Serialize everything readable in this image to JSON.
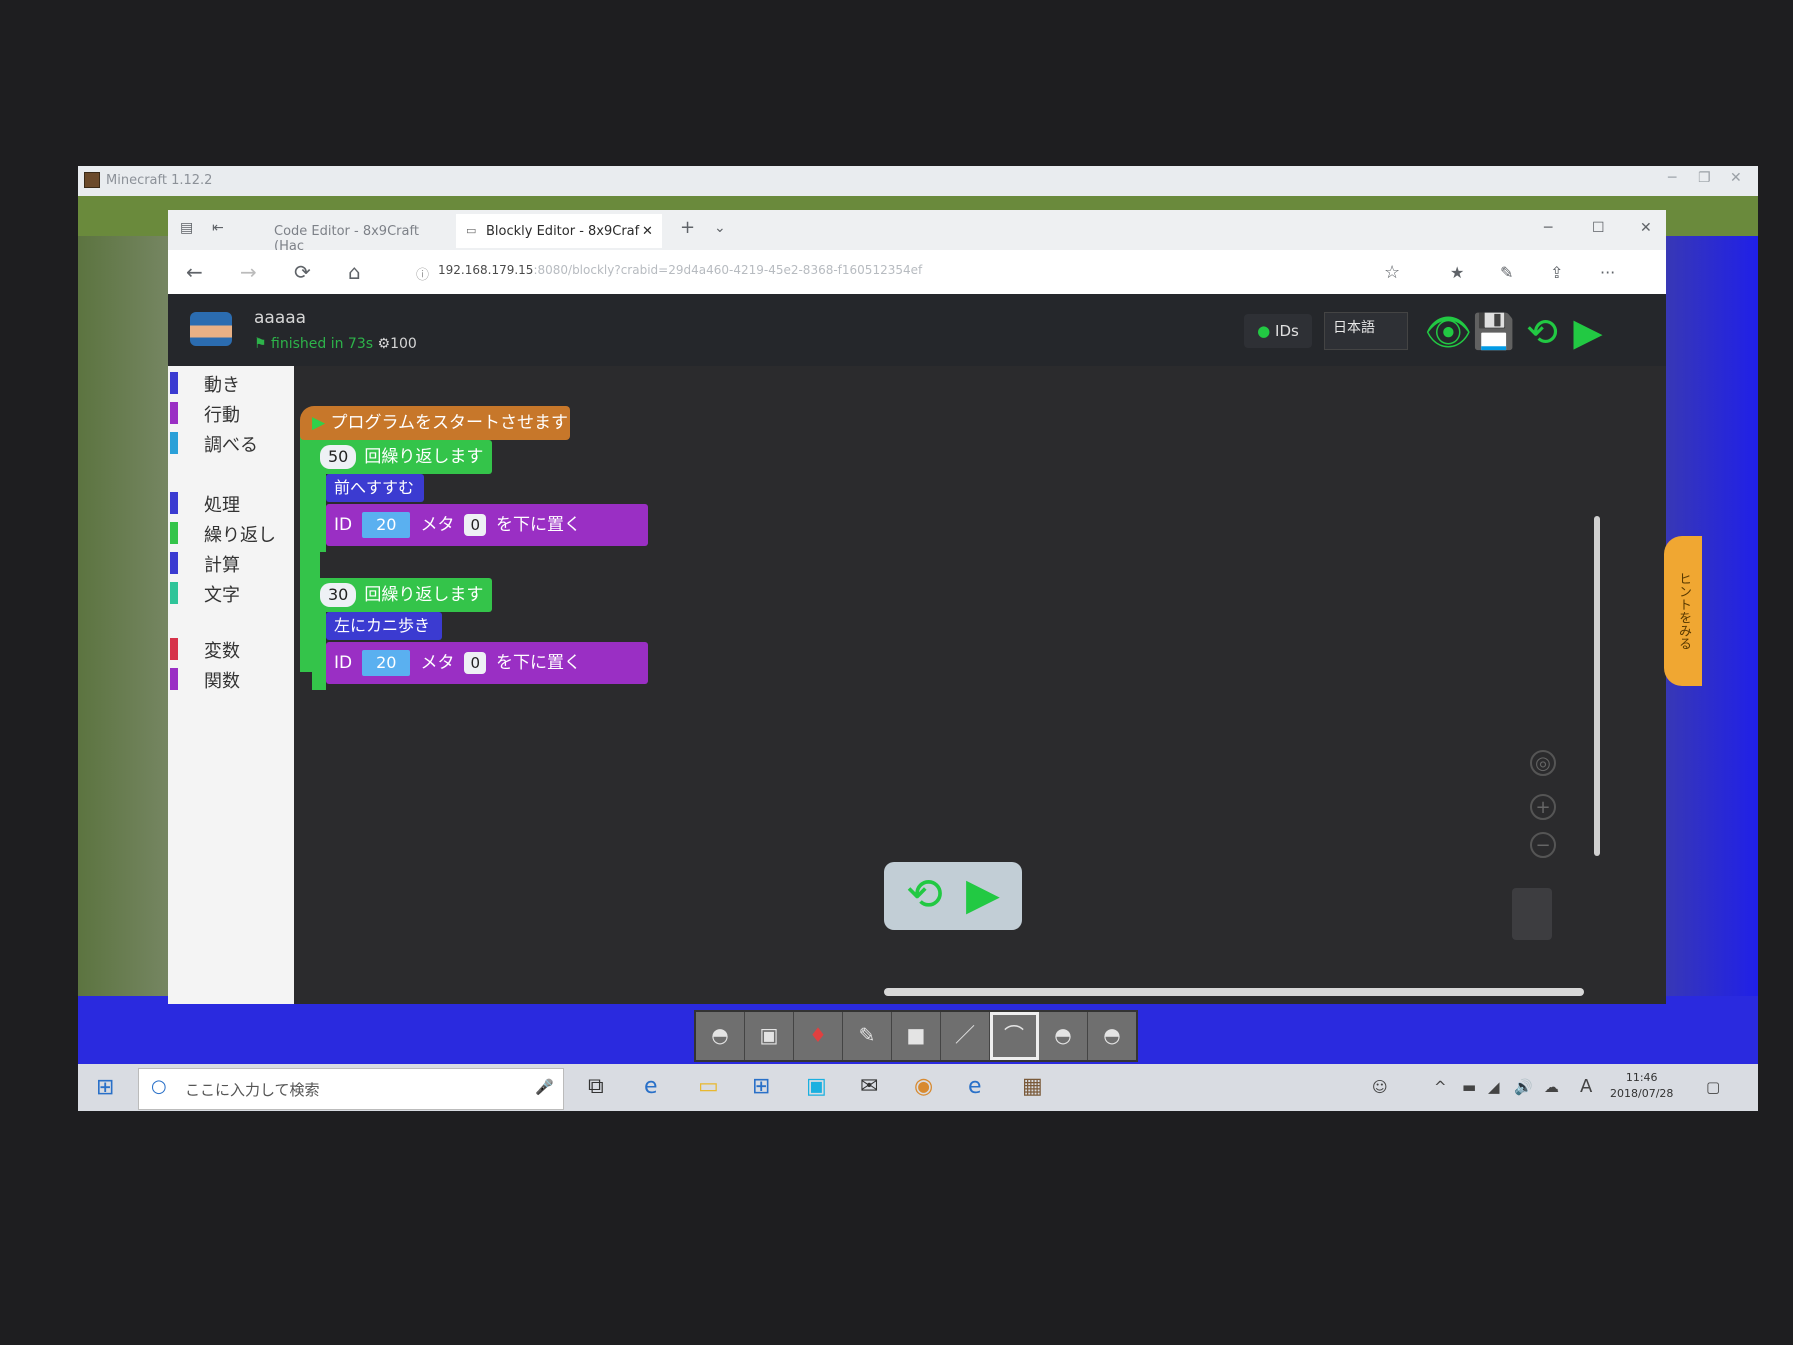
{
  "minecraft_window": {
    "title": "Minecraft 1.12.2",
    "controls": [
      "─",
      "❐",
      "✕"
    ]
  },
  "browser": {
    "tabs": [
      {
        "label": "Code Editor - 8x9Craft (Hac",
        "active": false
      },
      {
        "label": "Blockly Editor - 8x9Craf",
        "active": true
      }
    ],
    "tab_close": "✕",
    "new_tab": "+",
    "tab_menu": "⌄",
    "window_controls": [
      "─",
      "☐",
      "✕"
    ],
    "nav": {
      "back": "←",
      "forward": "→",
      "refresh": "⟳",
      "home": "⌂"
    },
    "url_host": "192.168.179.15",
    "url_rest": ":8080/blockly?crabid=29d4a460-4219-45e2-8368-f160512354ef",
    "toolbar_icons": {
      "favorite": "☆",
      "favorites": "★",
      "notes": "✎",
      "share": "⇪",
      "more": "···"
    }
  },
  "app": {
    "username": "aaaaa",
    "status_text": "finished in 73s",
    "count": "100",
    "ids_label": "IDs",
    "language": "日本語",
    "header_icons": {
      "view": "👁",
      "save": "💾",
      "reset": "⟲",
      "run": "▶"
    }
  },
  "toolbox": [
    {
      "label": "動き",
      "color": "#3b3bd1"
    },
    {
      "label": "行動",
      "color": "#9a2fc4"
    },
    {
      "label": "調べる",
      "color": "#2aa0d8"
    },
    {
      "label": "処理",
      "color": "#3b3bd1"
    },
    {
      "label": "繰り返し",
      "color": "#34c44a"
    },
    {
      "label": "計算",
      "color": "#3b3bd1"
    },
    {
      "label": "文字",
      "color": "#2fc499"
    },
    {
      "label": "変数",
      "color": "#d6334a"
    },
    {
      "label": "関数",
      "color": "#9a2fc4"
    }
  ],
  "blocks": {
    "start": "プログラムをスタートさせます",
    "loop1": {
      "count": "50",
      "label": "回繰り返します"
    },
    "move1": "前へすすむ",
    "place1": {
      "id_label": "ID",
      "id_value": "20",
      "meta_label": "メタ",
      "meta_value": "0",
      "action": "を下に置く"
    },
    "loop2": {
      "count": "30",
      "label": "回繰り返します"
    },
    "move2": "左にカニ歩き",
    "place2": {
      "id_label": "ID",
      "id_value": "20",
      "meta_label": "メタ",
      "meta_value": "0",
      "action": "を下に置く"
    }
  },
  "run_panel": {
    "reset": "⟲",
    "run": "▶"
  },
  "side_tab": "ヒントをみる",
  "zoom": {
    "center": "◎",
    "in": "+",
    "out": "−"
  },
  "hotbar": [
    "◓",
    "▣",
    "♦",
    "✎",
    "■",
    "／",
    "⌒",
    "◓",
    "◓"
  ],
  "taskbar": {
    "search_placeholder": "ここに入力して検索",
    "apps": [
      "e",
      "▭",
      "⊞",
      "▣",
      "✉",
      "◉",
      "e",
      "▦"
    ],
    "time": "11:46",
    "date": "2018/07/28",
    "ime": "A"
  },
  "colors": {
    "accent_green": "#22c943",
    "loop_green": "#34c44a",
    "motion_blue": "#3b3bd1",
    "action_purple": "#9a2fc4",
    "event_orange": "#c7772a"
  }
}
